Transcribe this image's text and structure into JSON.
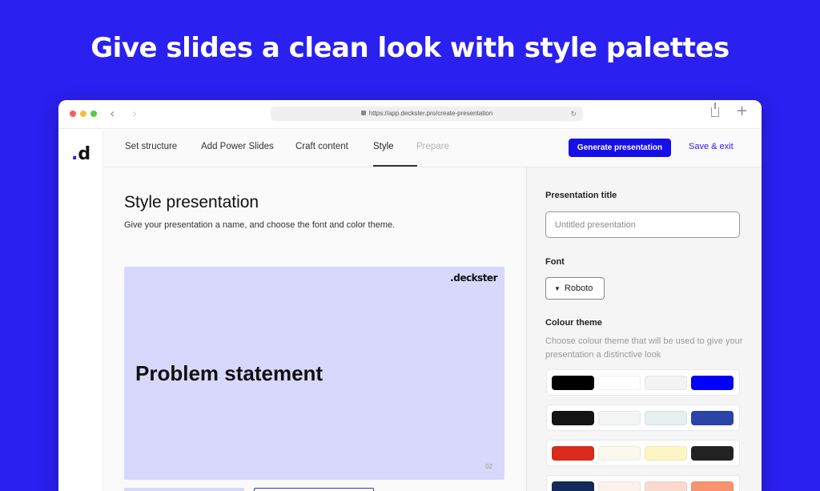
{
  "headline": "Give slides a clean look with style palettes",
  "browser": {
    "url": "https://app.deckster.pro/create-presentation"
  },
  "app": {
    "logo": ".d"
  },
  "nav": {
    "steps": [
      {
        "label": "Set structure",
        "state": "done"
      },
      {
        "label": "Add Power Slides",
        "state": "done"
      },
      {
        "label": "Craft content",
        "state": "done"
      },
      {
        "label": "Style",
        "state": "active"
      },
      {
        "label": "Prepare",
        "state": "disabled"
      }
    ],
    "generate_label": "Generate presentation",
    "save_label": "Save & exit"
  },
  "main": {
    "title": "Style presentation",
    "subtitle": "Give your presentation a name, and choose the font and color theme.",
    "slide": {
      "brand": ".deckster",
      "title": "Problem statement",
      "number": "02"
    }
  },
  "panel": {
    "title_label": "Presentation title",
    "title_placeholder": "Untitled presentation",
    "font_label": "Font",
    "font_value": "Roboto",
    "theme_label": "Colour theme",
    "theme_description": "Choose colour theme that will be used to give your presentation a distinctive look",
    "themes": [
      [
        "#000000",
        "#ffffff",
        "#f3f3f3",
        "#0000ff"
      ],
      [
        "#141414",
        "#f4f5f5",
        "#e6efed",
        "#2a44a8"
      ],
      [
        "#d92a1c",
        "#fbf8ec",
        "#fdf6c4",
        "#222222"
      ],
      [
        "#142a5a",
        "#fdf1ec",
        "#fcd9d0",
        "#f9926f"
      ]
    ]
  },
  "colors": {
    "background": "#2a20f0",
    "accent": "#1610e8",
    "slide_bg": "#d8d8fc"
  }
}
